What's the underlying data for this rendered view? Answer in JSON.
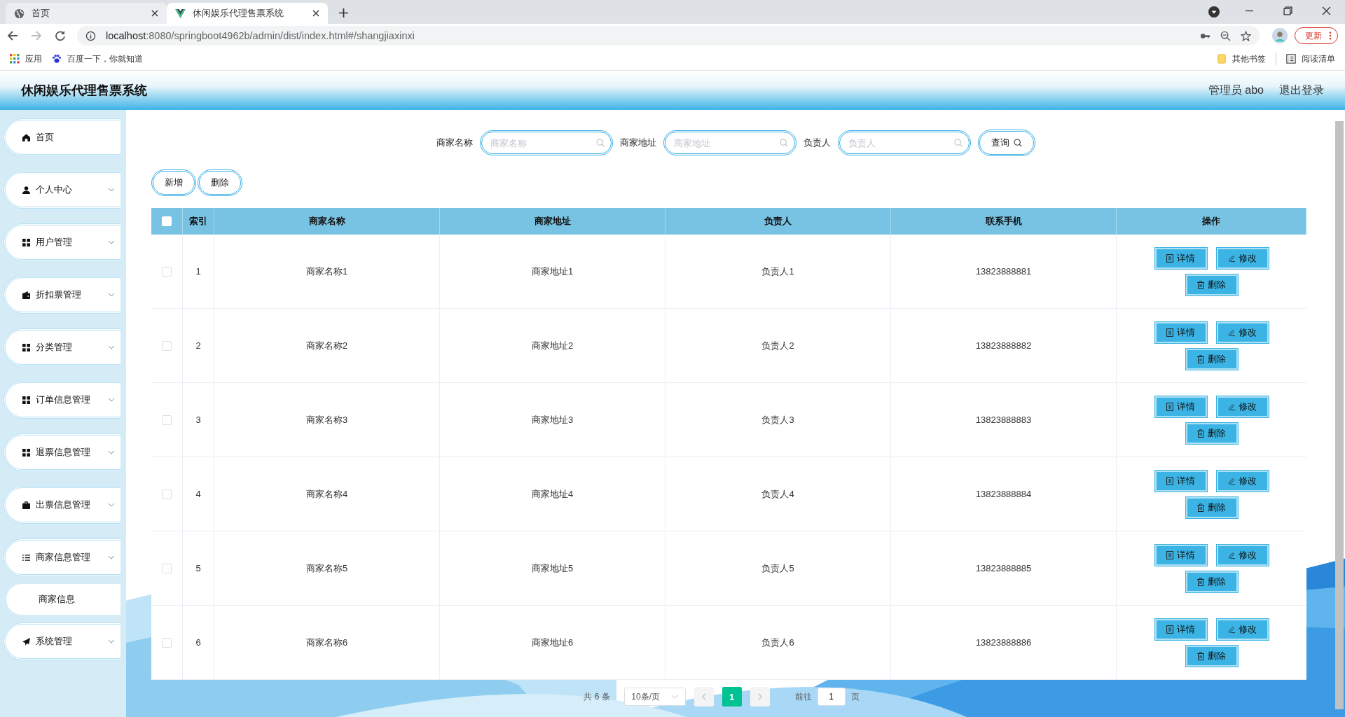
{
  "browser": {
    "tabs": [
      {
        "title": "首页",
        "selected": false
      },
      {
        "title": "休闲娱乐代理售票系统",
        "selected": true
      }
    ],
    "url_host": "localhost",
    "url_rest": ":8080/springboot4962b/admin/dist/index.html#/shangjiaxinxi",
    "update_label": "更新",
    "bookmarks": [
      {
        "label": "应用"
      },
      {
        "label": "百度一下，你就知道"
      }
    ],
    "bookmarks_right": [
      {
        "label": "其他书签"
      },
      {
        "label": "阅读清单"
      }
    ]
  },
  "header": {
    "title": "休闲娱乐代理售票系统",
    "user": "管理员 abo",
    "logout": "退出登录"
  },
  "sidebar": {
    "items": [
      {
        "label": "首页",
        "kind": "link"
      },
      {
        "label": "个人中心",
        "kind": "menu"
      },
      {
        "label": "用户管理",
        "kind": "menu"
      },
      {
        "label": "折扣票管理",
        "kind": "menu"
      },
      {
        "label": "分类管理",
        "kind": "menu"
      },
      {
        "label": "订单信息管理",
        "kind": "menu"
      },
      {
        "label": "退票信息管理",
        "kind": "menu"
      },
      {
        "label": "出票信息管理",
        "kind": "menu"
      },
      {
        "label": "商家信息管理",
        "kind": "menu",
        "children": [
          {
            "label": "商家信息"
          }
        ]
      },
      {
        "label": "系统管理",
        "kind": "menu"
      }
    ]
  },
  "search": {
    "fields": [
      {
        "label": "商家名称",
        "placeholder": "商家名称"
      },
      {
        "label": "商家地址",
        "placeholder": "商家地址"
      },
      {
        "label": "负责人",
        "placeholder": "负责人"
      }
    ],
    "button": "查询"
  },
  "toolbar": [
    "新增",
    "删除"
  ],
  "table": {
    "header_checked": false,
    "columns": [
      "索引",
      "商家名称",
      "商家地址",
      "负责人",
      "联系手机",
      "操作"
    ],
    "rows": [
      {
        "checked": false,
        "cells": [
          "1",
          "商家名称1",
          "商家地址1",
          "负责人1",
          "13823888881"
        ],
        "actions": [
          "详情",
          "修改",
          "删除"
        ]
      },
      {
        "checked": false,
        "cells": [
          "2",
          "商家名称2",
          "商家地址2",
          "负责人2",
          "13823888882"
        ],
        "actions": [
          "详情",
          "修改",
          "删除"
        ]
      },
      {
        "checked": false,
        "cells": [
          "3",
          "商家名称3",
          "商家地址3",
          "负责人3",
          "13823888883"
        ],
        "actions": [
          "详情",
          "修改",
          "删除"
        ]
      },
      {
        "checked": false,
        "cells": [
          "4",
          "商家名称4",
          "商家地址4",
          "负责人4",
          "13823888884"
        ],
        "actions": [
          "详情",
          "修改",
          "删除"
        ]
      },
      {
        "checked": false,
        "cells": [
          "5",
          "商家名称5",
          "商家地址5",
          "负责人5",
          "13823888885"
        ],
        "actions": [
          "详情",
          "修改",
          "删除"
        ]
      },
      {
        "checked": false,
        "cells": [
          "6",
          "商家名称6",
          "商家地址6",
          "负责人6",
          "13823888886"
        ],
        "actions": [
          "详情",
          "修改",
          "删除"
        ]
      }
    ]
  },
  "pagination": {
    "total": "共 6 条",
    "page_size": "10条/页",
    "pages": [
      {
        "label": "1",
        "selected": true
      }
    ],
    "goto_label": "前往",
    "goto_value": "1",
    "goto_suffix": "页"
  }
}
